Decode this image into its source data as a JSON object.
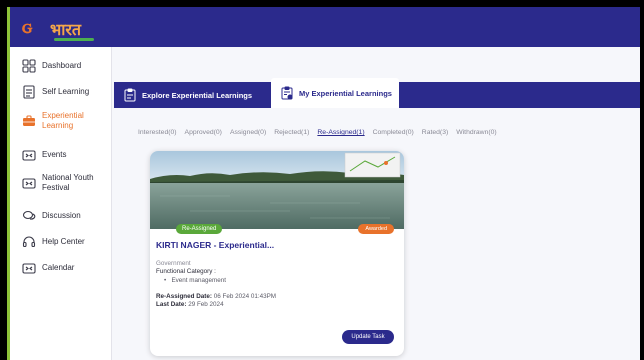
{
  "colors": {
    "brand_navy": "#2b2a8c",
    "accent_orange": "#e8722b",
    "status_green": "#5aa83a",
    "sidebar_border_green": "#8fc43a"
  },
  "header": {
    "logo_text": "भारत"
  },
  "sidebar": {
    "items": [
      {
        "label": "Dashboard",
        "icon": "dashboard-grid-icon"
      },
      {
        "label": "Self Learning",
        "icon": "document-list-icon"
      },
      {
        "label": "Experiential Learning",
        "icon": "briefcase-icon",
        "active": true
      },
      {
        "label": "Events",
        "icon": "events-icon"
      },
      {
        "label": "National Youth Festival",
        "icon": "festival-icon"
      },
      {
        "label": "Discussion",
        "icon": "discussion-bubbles-icon"
      },
      {
        "label": "Help Center",
        "icon": "headset-icon"
      },
      {
        "label": "Calendar",
        "icon": "calendar-icon"
      }
    ]
  },
  "tabs": {
    "explore": "Explore Experiential Learnings",
    "mine": "My Experiential Learnings",
    "active": "mine"
  },
  "filters": [
    {
      "label": "Interested(0)"
    },
    {
      "label": "Approved(0)"
    },
    {
      "label": "Assigned(0)"
    },
    {
      "label": "Rejected(1)"
    },
    {
      "label": "Re-Assigned(1)",
      "active": true
    },
    {
      "label": "Completed(0)"
    },
    {
      "label": "Rated(3)"
    },
    {
      "label": "Withdrawn(0)"
    }
  ],
  "card": {
    "status_badge": "Re-Assigned",
    "award_badge": "Awarded",
    "title": "KIRTI NAGER - Experiential...",
    "organization_type": "Government",
    "category_label": "Functional Category :",
    "category_value": "Event management",
    "reassigned_label": "Re-Assigned Date:",
    "reassigned_value": "06 Feb 2024 01:43PM",
    "last_label": "Last Date:",
    "last_value": "29 Feb 2024",
    "button_label": "Update Task"
  }
}
